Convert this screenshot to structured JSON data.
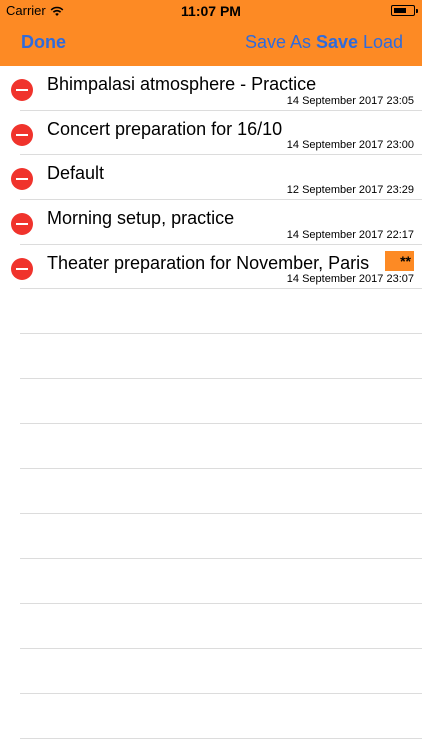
{
  "status_bar": {
    "carrier": "Carrier",
    "time": "11:07 PM"
  },
  "nav": {
    "done": "Done",
    "save_as": "Save As",
    "save": "Save",
    "load": "Load"
  },
  "items": [
    {
      "title": "Bhimpalasi atmosphere - Practice",
      "date": "14 September 2017 23:05"
    },
    {
      "title": "Concert preparation for 16/10",
      "date": "14 September 2017 23:00"
    },
    {
      "title": "Default",
      "date": "12 September 2017 23:29"
    },
    {
      "title": "Morning setup, practice",
      "date": "14 September 2017 22:17"
    },
    {
      "title": "Theater preparation for November, Paris",
      "date": "14 September 2017 23:07",
      "badge": "**"
    }
  ],
  "colors": {
    "accent": "#fd8a24",
    "link": "#2f6bdc",
    "delete": "#f0332c"
  }
}
